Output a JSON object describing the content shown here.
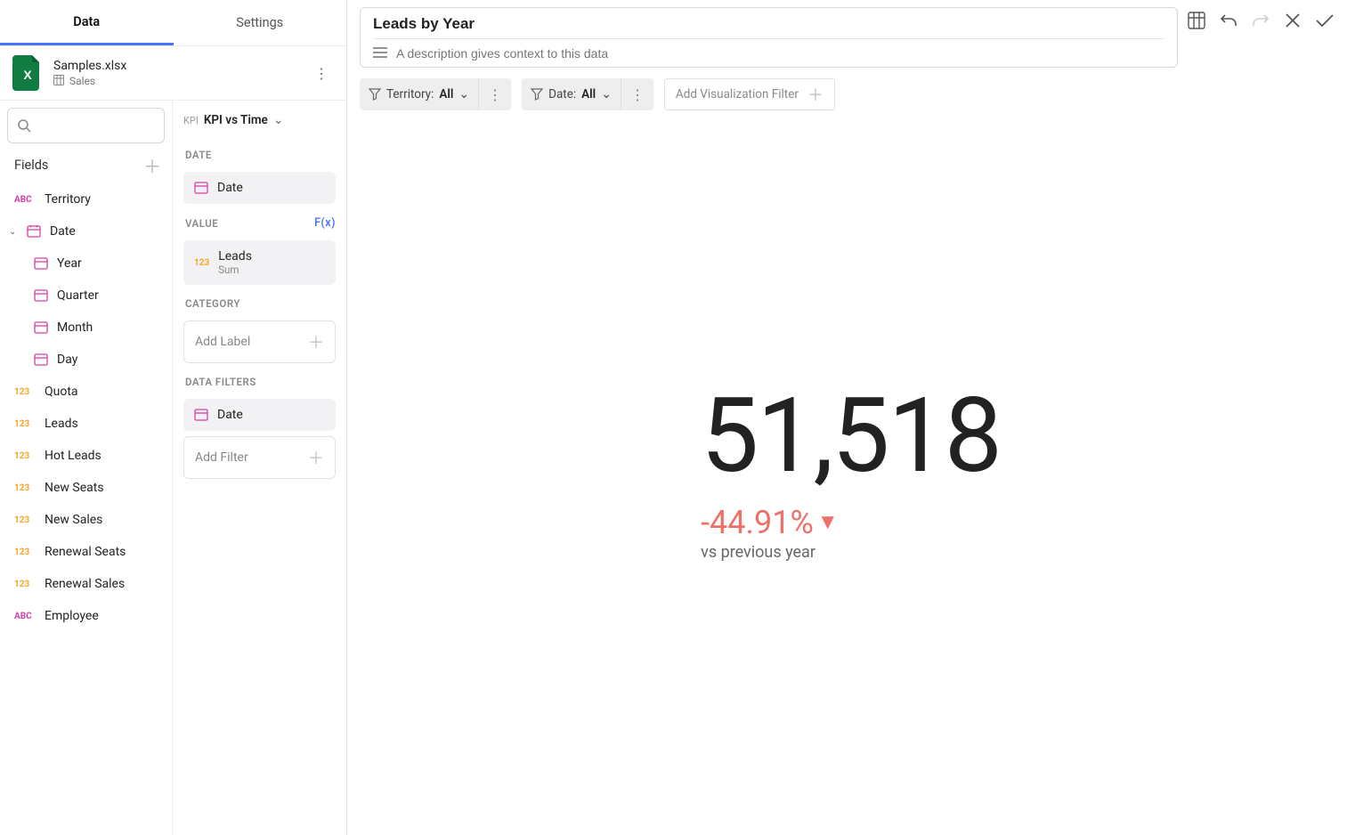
{
  "tabs": {
    "data": "Data",
    "settings": "Settings"
  },
  "datasource": {
    "file": "Samples.xlsx",
    "sheet": "Sales"
  },
  "search_placeholder": "",
  "fields_header": "Fields",
  "fields": {
    "territory": "Territory",
    "date": "Date",
    "year": "Year",
    "quarter": "Quarter",
    "month": "Month",
    "day": "Day",
    "quota": "Quota",
    "leads": "Leads",
    "hot_leads": "Hot Leads",
    "new_seats": "New Seats",
    "new_sales": "New Sales",
    "renewal_seats": "Renewal Seats",
    "renewal_sales": "Renewal Sales",
    "employee": "Employee"
  },
  "viz": {
    "prefix": "KPI",
    "name": "KPI vs Time"
  },
  "sections": {
    "date": "DATE",
    "value": "VALUE",
    "fx": "F(x)",
    "category": "CATEGORY",
    "data_filters": "DATA FILTERS"
  },
  "config": {
    "date_chip": "Date",
    "value_chip": "Leads",
    "value_agg": "Sum",
    "add_label": "Add Label",
    "filter_chip": "Date",
    "add_filter": "Add Filter"
  },
  "title": "Leads by Year",
  "description_placeholder": "A description gives context to this data",
  "filters": {
    "territory_label": "Territory:",
    "territory_value": "All",
    "date_label": "Date:",
    "date_value": "All",
    "add": "Add Visualization Filter"
  },
  "kpi": {
    "value": "51,518",
    "delta": "-44.91%",
    "sub": "vs previous year"
  },
  "badges": {
    "abc": "ABC",
    "num": "123"
  },
  "chart_data": {
    "type": "kpi",
    "metric": "Leads",
    "aggregation": "Sum",
    "time_field": "Date",
    "grain": "Year",
    "value": 51518,
    "delta_pct": -44.91,
    "comparison": "previous year",
    "filters": {
      "Territory": "All",
      "Date": "All"
    },
    "title": "Leads by Year"
  }
}
